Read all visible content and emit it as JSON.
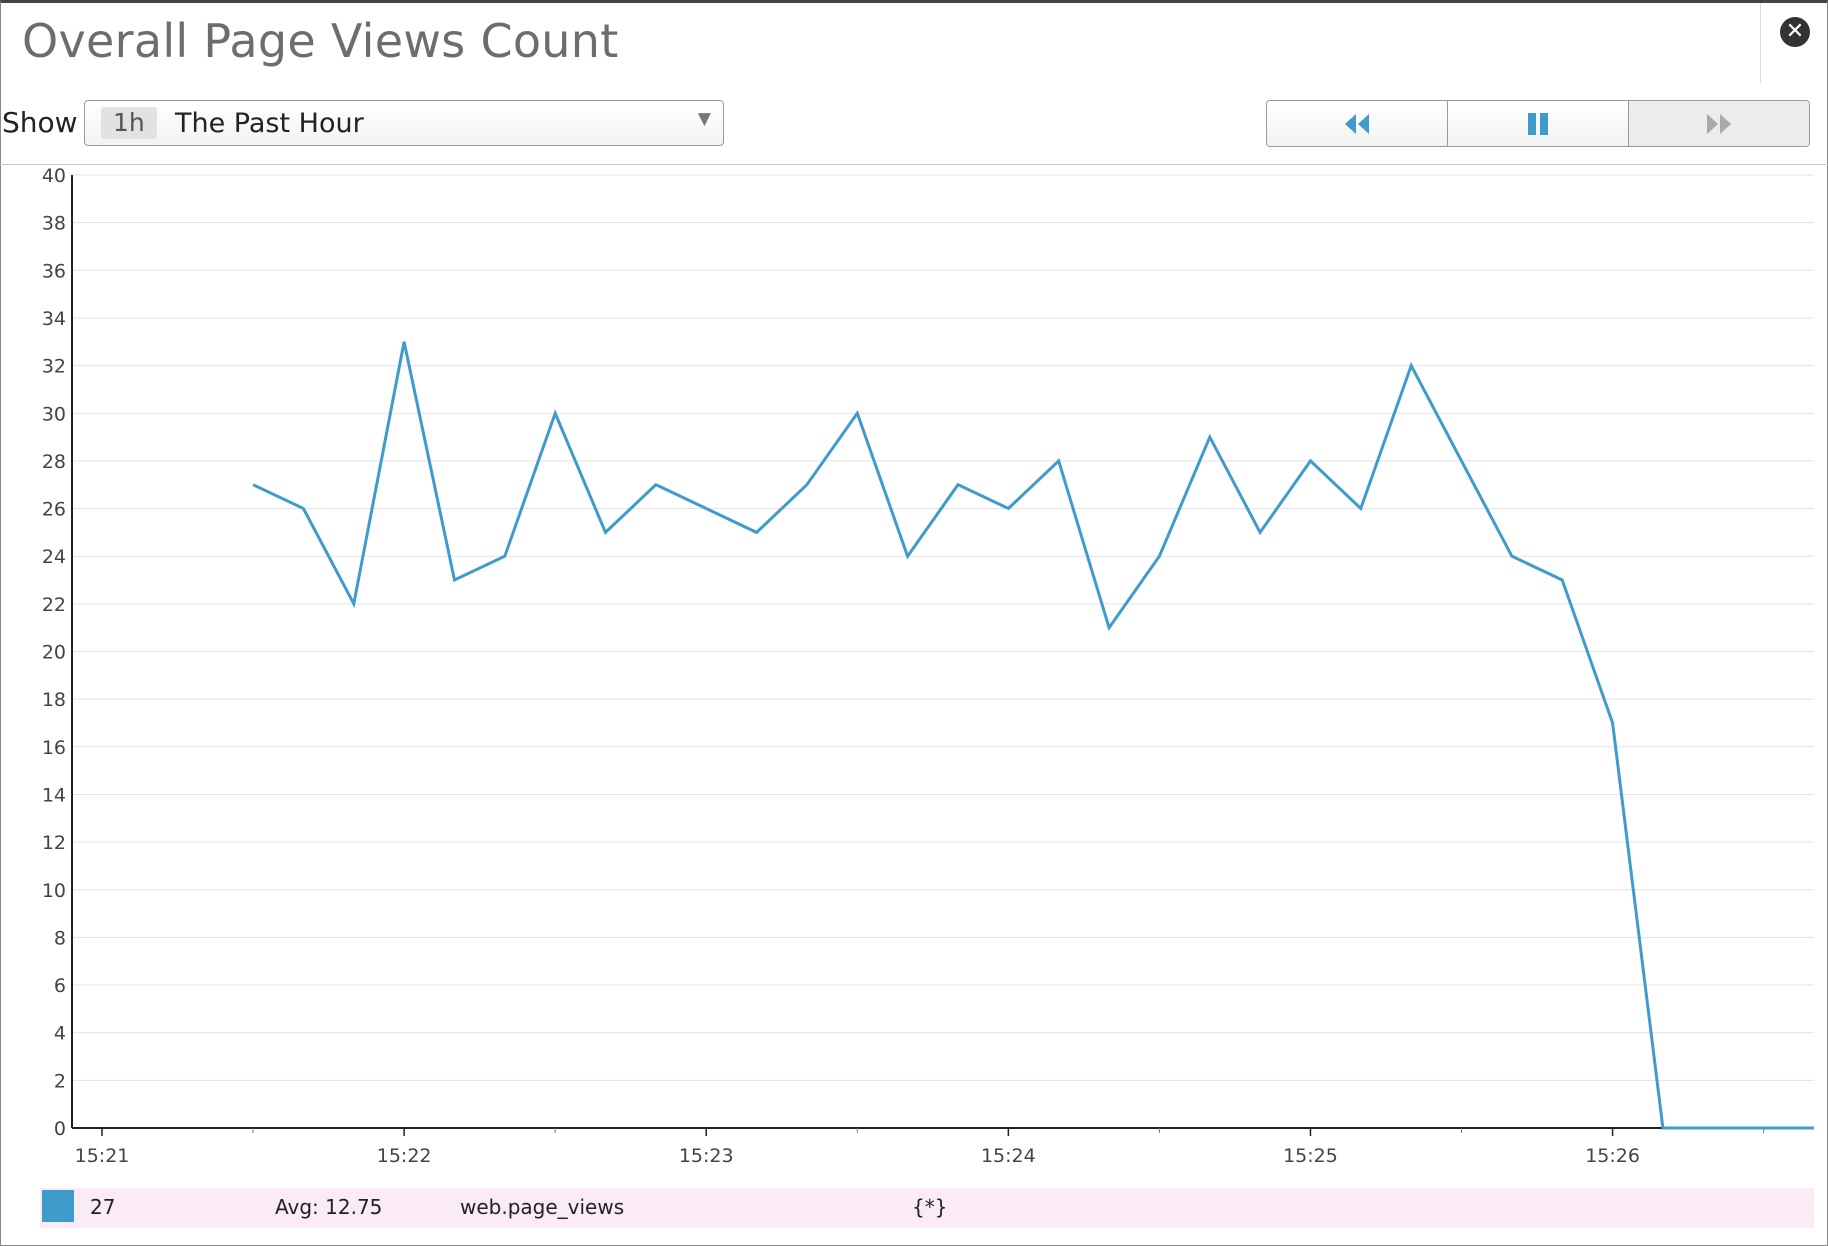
{
  "widget": {
    "title": "Overall Page Views Count",
    "close_icon": "close-icon"
  },
  "controls": {
    "show_label": "Show",
    "timeframe_badge": "1h",
    "timeframe_label": "The Past Hour",
    "caret": "▼",
    "playback": {
      "rewind_icon": "rewind-icon",
      "pause_icon": "pause-icon",
      "forward_icon": "fast-forward-icon",
      "forward_enabled": false
    }
  },
  "colors": {
    "series": "#3f9bcb",
    "legend_bg": "#fbebf6",
    "grid": "#e3e3e3"
  },
  "chart_data": {
    "type": "line",
    "title": "Overall Page Views Count",
    "xlabel": "",
    "ylabel": "",
    "x_ticks": [
      "15:21",
      "15:22",
      "15:23",
      "15:24",
      "15:25",
      "15:26"
    ],
    "x_range": [
      "15:21:00",
      "15:26:40"
    ],
    "ylim": [
      0,
      40
    ],
    "y_ticks": [
      0,
      2,
      4,
      6,
      8,
      10,
      12,
      14,
      16,
      18,
      20,
      22,
      24,
      26,
      28,
      30,
      32,
      34,
      36,
      38,
      40
    ],
    "grid": true,
    "series": [
      {
        "name": "web.page_views",
        "color": "#3f9bcb",
        "x": [
          "15:21:30",
          "15:21:40",
          "15:21:50",
          "15:22:00",
          "15:22:10",
          "15:22:20",
          "15:22:30",
          "15:22:40",
          "15:22:50",
          "15:23:00",
          "15:23:10",
          "15:23:20",
          "15:23:30",
          "15:23:40",
          "15:23:50",
          "15:24:00",
          "15:24:10",
          "15:24:20",
          "15:24:30",
          "15:24:40",
          "15:24:50",
          "15:25:00",
          "15:25:10",
          "15:25:20",
          "15:25:30",
          "15:25:40",
          "15:25:50",
          "15:26:00",
          "15:26:10",
          "15:26:40"
        ],
        "y": [
          27,
          26,
          22,
          33,
          23,
          24,
          30,
          25,
          27,
          26,
          25,
          27,
          30,
          24,
          27,
          26,
          28,
          21,
          24,
          29,
          25,
          28,
          26,
          32,
          28,
          24,
          23,
          17,
          0,
          0
        ]
      }
    ],
    "legend": {
      "value": "27",
      "avg": "Avg: 12.75",
      "metric": "web.page_views",
      "scope": "{*}"
    }
  }
}
